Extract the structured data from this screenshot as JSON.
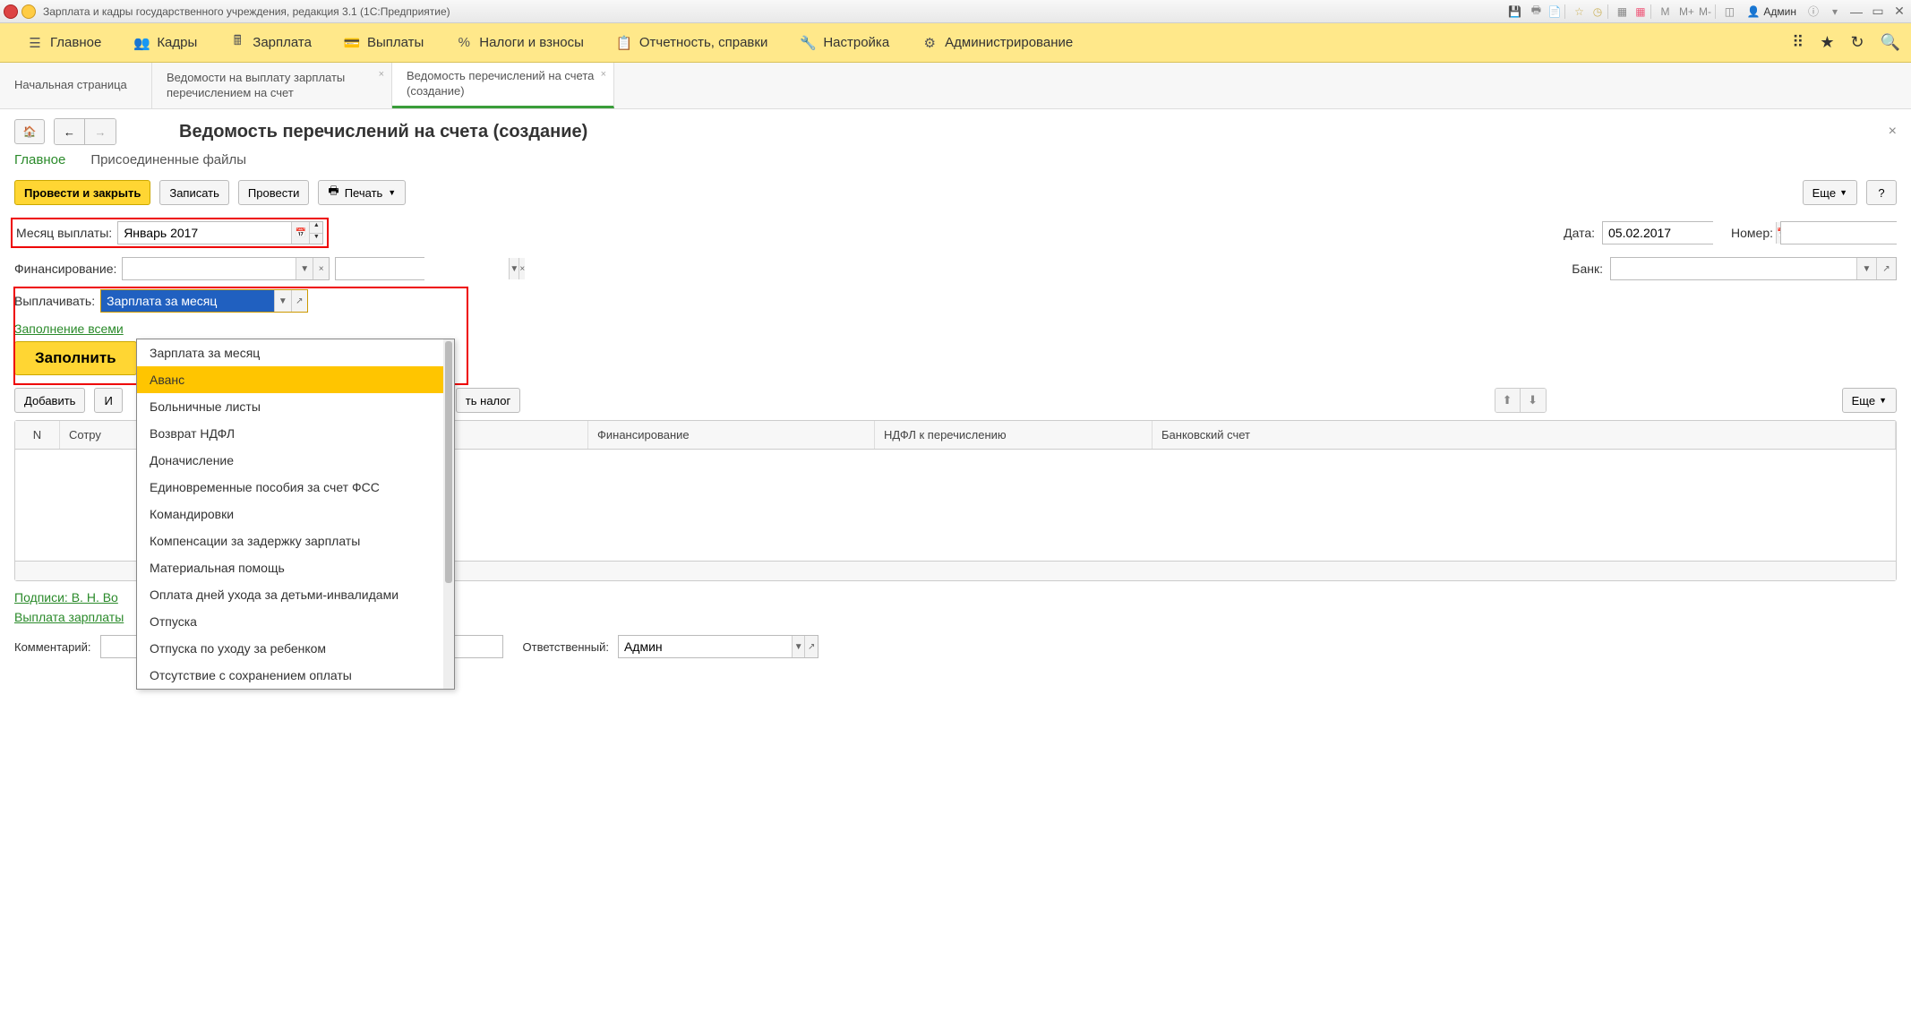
{
  "titlebar": {
    "title": "Зарплата и кадры государственного учреждения, редакция 3.1  (1С:Предприятие)",
    "user": "Админ"
  },
  "menu": {
    "items": [
      {
        "label": "Главное",
        "icon": "menu"
      },
      {
        "label": "Кадры",
        "icon": "people"
      },
      {
        "label": "Зарплата",
        "icon": "calc"
      },
      {
        "label": "Выплаты",
        "icon": "wallet"
      },
      {
        "label": "Налоги и взносы",
        "icon": "percent"
      },
      {
        "label": "Отчетность, справки",
        "icon": "report"
      },
      {
        "label": "Настройка",
        "icon": "wrench"
      },
      {
        "label": "Администрирование",
        "icon": "gear"
      }
    ]
  },
  "tabs": {
    "items": [
      {
        "label": "Начальная страница",
        "closable": false
      },
      {
        "label": "Ведомости на выплату зарплаты перечислением на счет",
        "closable": true
      },
      {
        "label": "Ведомость перечислений на счета (создание)",
        "closable": true,
        "active": true
      }
    ]
  },
  "page": {
    "title": "Ведомость перечислений на счета (создание)",
    "subtabs": {
      "main": "Главное",
      "files": "Присоединенные файлы"
    },
    "actions": {
      "post_close": "Провести и закрыть",
      "save": "Записать",
      "post": "Провести",
      "print": "Печать",
      "more": "Еще",
      "help": "?"
    },
    "form": {
      "month_label": "Месяц выплаты:",
      "month_value": "Январь 2017",
      "date_label": "Дата:",
      "date_value": "05.02.2017",
      "number_label": "Номер:",
      "number_value": "",
      "financing_label": "Финансирование:",
      "financing_value": "",
      "bank_label": "Банк:",
      "bank_value": "",
      "pay_label": "Выплачивать:",
      "pay_value": "Зарплата за месяц",
      "fill_all_link": "Заполнение всеми",
      "fill_btn": "Заполнить",
      "add_btn": "Добавить",
      "tax_btn": "ть налог",
      "more2": "Еще"
    },
    "dropdown": [
      "Зарплата за месяц",
      "Аванс",
      "Больничные листы",
      "Возврат НДФЛ",
      "Доначисление",
      "Единовременные пособия за счет ФСС",
      "Командировки",
      "Компенсации за задержку зарплаты",
      "Материальная помощь",
      "Оплата дней ухода за детьми-инвалидами",
      "Отпуска",
      "Отпуска по уходу за ребенком",
      "Отсутствие с сохранением оплаты"
    ],
    "grid_headers": [
      "N",
      "Сотру",
      "",
      "Финансирование",
      "НДФЛ к перечислению",
      "Банковский счет"
    ],
    "footer": {
      "sign_link": "Подписи: В. Н. Во",
      "payout_link": "Выплата зарплаты",
      "comment_label": "Комментарий:",
      "resp_label": "Ответственный:",
      "resp_value": "Админ"
    }
  }
}
